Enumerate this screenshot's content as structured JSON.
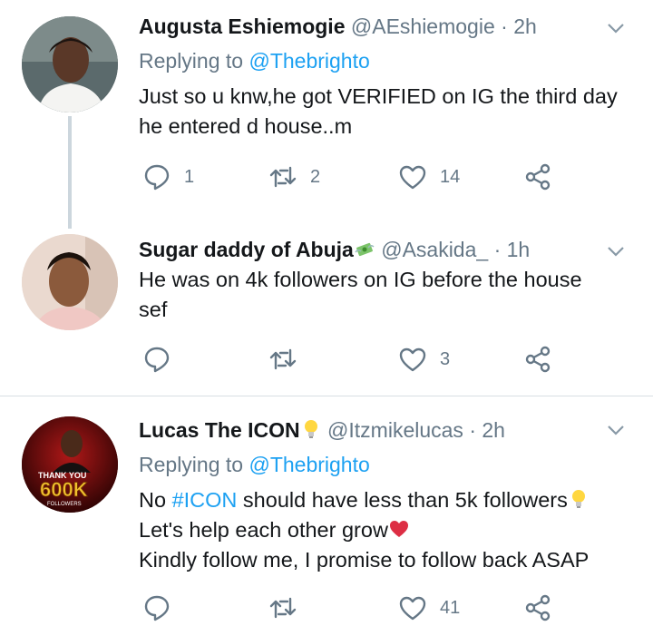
{
  "tweets": [
    {
      "name": "Augusta Eshiemogie",
      "handle": "@AEshiemogie",
      "separator": "·",
      "time": "2h",
      "replying_label": "Replying to",
      "replying_handle": "@Thebrighto",
      "text_lines": [
        "Just so u knw,he got VERIFIED on IG the third day",
        "he entered d house..m"
      ],
      "reply_count": "1",
      "retweet_count": "2",
      "like_count": "14"
    },
    {
      "name": "Sugar daddy of Abuja",
      "name_emoji": "money-with-wings",
      "handle": "@Asakida_",
      "separator": "·",
      "time": "1h",
      "text_lines": [
        "He was on 4k followers on IG before the house",
        "sef"
      ],
      "reply_count": "",
      "retweet_count": "",
      "like_count": "3"
    },
    {
      "name": "Lucas The ICON",
      "name_emoji": "light-bulb",
      "handle": "@Itzmikelucas",
      "separator": "·",
      "time": "2h",
      "replying_label": "Replying to",
      "replying_handle": "@Thebrighto",
      "line1_pre": "No ",
      "line1_hashtag": "#ICON",
      "line1_post": " should have less than 5k followers",
      "line2": "Let's help each other grow",
      "line3": "Kindly follow me, I promise to follow back ASAP",
      "avatar_text": {
        "top": "THANK YOU",
        "big": "600K",
        "bottom": "FOLLOWERS"
      },
      "reply_count": "",
      "retweet_count": "",
      "like_count": "41"
    }
  ],
  "colors": {
    "name": "#14171a",
    "meta": "#657786",
    "link": "#1da1f2",
    "thread_line": "#ccd6dd",
    "divider": "#d8dee3"
  }
}
